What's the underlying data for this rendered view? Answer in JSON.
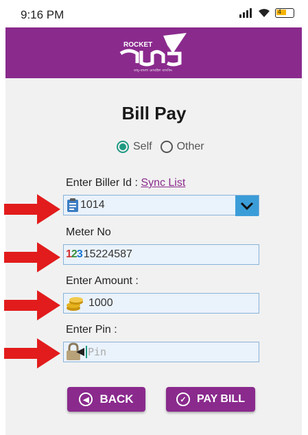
{
  "status_bar": {
    "time": "9:16 PM",
    "battery": "4"
  },
  "header": {
    "logo_text": "ROCKET",
    "logo_bengali": "রকেট",
    "logo_tagline": "ডাচ্-বাংলা মোবাইল ব্যাংকিং"
  },
  "page": {
    "title": "Bill Pay"
  },
  "payer": {
    "self_label": "Self",
    "other_label": "Other",
    "selected": "Self"
  },
  "biller": {
    "label": "Enter Biller Id :",
    "sync_link": "Sync List",
    "value": "1014"
  },
  "meter": {
    "label": "Meter No",
    "icon_text": "123",
    "value": "15224587"
  },
  "amount": {
    "label": "Enter Amount :",
    "value": "1000"
  },
  "pin": {
    "label": "Enter Pin :",
    "placeholder": "Pin"
  },
  "buttons": {
    "back": "BACK",
    "pay": "PAY BILL"
  },
  "colors": {
    "brand": "#8a2a8d",
    "field_bg": "#eaf2fb",
    "field_border": "#86b2d8",
    "dropdown": "#3b9dd8",
    "radio": "#1e9a82",
    "arrow": "#e21c1c"
  }
}
